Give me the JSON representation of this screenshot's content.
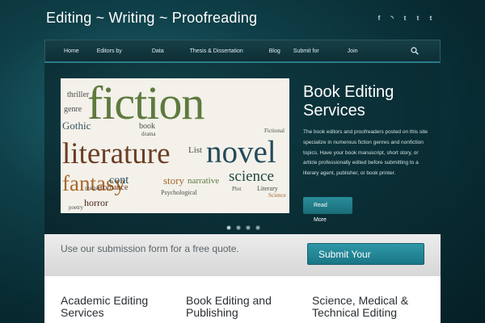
{
  "site": {
    "title": "Editing ~ Writing ~ Proofreading"
  },
  "social": [
    "facebook-icon",
    "rss-icon",
    "twitter-icon",
    "tumblr-icon",
    "tumblr-icon"
  ],
  "nav": {
    "items": [
      "Home",
      "Editors by",
      "Data",
      "Thesis & Dissertation",
      "Blog",
      "Submit for",
      "Join"
    ]
  },
  "hero": {
    "title": "Book Editing Services",
    "text": "The book editors and proofreaders posted on this site specialize in numerous fiction genres and nonfiction topics. Have your book manuscript, short story, or article professionally edited before submitting to a literary agent, publisher, or book printer.",
    "read_label": "Read",
    "more_label": "More",
    "cloud_words": [
      "fiction",
      "literature",
      "novel",
      "fantasy",
      "science",
      "thriller",
      "genre",
      "Gothic",
      "story",
      "narrative",
      "horror",
      "romance",
      "book",
      "List",
      "Fictional",
      "Psychological",
      "Literary",
      "Plot",
      "cont",
      "realism",
      "poetry",
      "drama",
      "Science"
    ]
  },
  "quote": {
    "text": "Use our submission form for a free quote.",
    "button": "Submit Your"
  },
  "columns": [
    {
      "title": "Academic Editing Services"
    },
    {
      "title": "Book Editing and Publishing"
    },
    {
      "title": "Science, Medical & Technical Editing"
    }
  ]
}
